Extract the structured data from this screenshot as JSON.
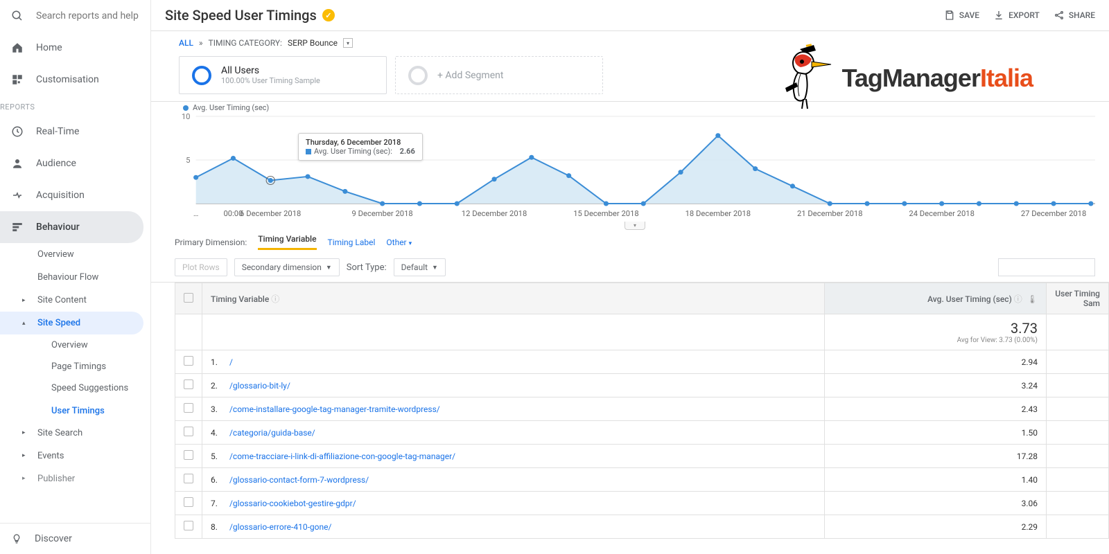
{
  "search": {
    "placeholder": "Search reports and help"
  },
  "nav": {
    "home": "Home",
    "customisation": "Customisation",
    "reports_label": "REPORTS",
    "realtime": "Real-Time",
    "audience": "Audience",
    "acquisition": "Acquisition",
    "behaviour": "Behaviour",
    "behaviour_items": {
      "overview": "Overview",
      "flow": "Behaviour Flow",
      "site_content": "Site Content",
      "site_speed": "Site Speed",
      "ss_overview": "Overview",
      "page_timings": "Page Timings",
      "speed_suggestions": "Speed Suggestions",
      "user_timings": "User Timings",
      "site_search": "Site Search",
      "events": "Events",
      "publisher": "Publisher"
    },
    "discover": "Discover"
  },
  "header": {
    "title": "Site Speed User Timings",
    "save": "SAVE",
    "export": "EXPORT",
    "share": "SHARE"
  },
  "breadcrumb": {
    "all": "ALL",
    "sep": "»",
    "label": "TIMING CATEGORY:",
    "value": "SERP Bounce"
  },
  "segments": {
    "all_users": "All Users",
    "all_users_sub": "100.00% User Timing Sample",
    "add": "+ Add Segment"
  },
  "logo": {
    "a": "TagManager",
    "b": "Italia"
  },
  "chart_legend": "Avg. User Timing (sec)",
  "chart_data": {
    "type": "line",
    "title": "",
    "xlabel": "",
    "ylabel": "",
    "ylim": [
      0,
      10
    ],
    "yticks": [
      5,
      10
    ],
    "x": [
      "…",
      "00:00",
      "6 Dec",
      "7 Dec",
      "8 Dec",
      "9 Dec",
      "10 Dec",
      "11 Dec",
      "12 Dec",
      "13 Dec",
      "14 Dec",
      "15 Dec",
      "16 Dec",
      "17 Dec",
      "18 Dec",
      "19 Dec",
      "20 Dec",
      "21 Dec",
      "22 Dec",
      "23 Dec",
      "24 Dec",
      "25 Dec",
      "26 Dec",
      "27 Dec",
      "28 Dec"
    ],
    "x_labels_shown": [
      "…",
      "00:00",
      "6 December 2018",
      "9 December 2018",
      "12 December 2018",
      "15 December 2018",
      "18 December 2018",
      "21 December 2018",
      "24 December 2018",
      "27 December 2018"
    ],
    "series": [
      {
        "name": "Avg. User Timing (sec)",
        "values": [
          3.0,
          5.2,
          2.66,
          3.1,
          1.4,
          0,
          0,
          0,
          2.8,
          5.3,
          3.2,
          0,
          0,
          3.6,
          7.8,
          4.0,
          2.0,
          0,
          0,
          0,
          0,
          0,
          0,
          0,
          0
        ]
      }
    ]
  },
  "tooltip": {
    "title": "Thursday, 6 December 2018",
    "metric": "Avg. User Timing (sec):",
    "value": "2.66"
  },
  "dimension_bar": {
    "primary_label": "Primary Dimension:",
    "timing_variable": "Timing Variable",
    "timing_label": "Timing Label",
    "other": "Other"
  },
  "controls": {
    "plot_rows": "Plot Rows",
    "secondary": "Secondary dimension",
    "sort_label": "Sort Type:",
    "sort_default": "Default"
  },
  "table": {
    "col_variable": "Timing Variable",
    "col_avg": "Avg. User Timing (sec)",
    "col_sample": "User Timing Sam",
    "summary_value": "3.73",
    "summary_sub": "Avg for View: 3.73 (0.00%)",
    "rows": [
      {
        "n": "1.",
        "path": "/",
        "avg": "2.94"
      },
      {
        "n": "2.",
        "path": "/glossario-bit-ly/",
        "avg": "3.24"
      },
      {
        "n": "3.",
        "path": "/come-installare-google-tag-manager-tramite-wordpress/",
        "avg": "2.43"
      },
      {
        "n": "4.",
        "path": "/categoria/guida-base/",
        "avg": "1.50"
      },
      {
        "n": "5.",
        "path": "/come-tracciare-i-link-di-affiliazione-con-google-tag-manager/",
        "avg": "17.28"
      },
      {
        "n": "6.",
        "path": "/glossario-contact-form-7-wordpress/",
        "avg": "1.40"
      },
      {
        "n": "7.",
        "path": "/glossario-cookiebot-gestire-gdpr/",
        "avg": "3.06"
      },
      {
        "n": "8.",
        "path": "/glossario-errore-410-gone/",
        "avg": "2.29"
      }
    ]
  }
}
